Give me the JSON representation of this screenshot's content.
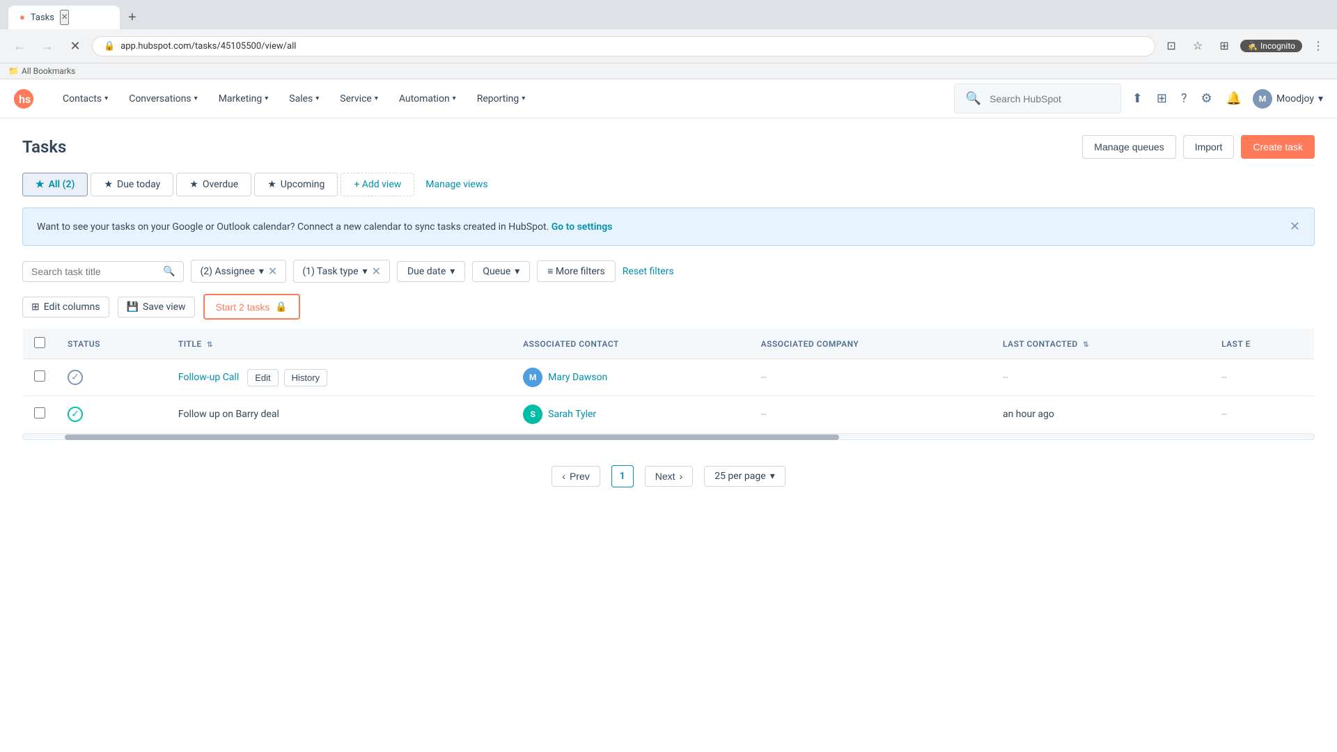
{
  "browser": {
    "tab_title": "Tasks",
    "tab_close": "×",
    "new_tab": "+",
    "url": "app.hubspot.com/tasks/45105500/view/all",
    "nav": {
      "back": "←",
      "forward": "→",
      "reload": "✕",
      "home": "⌂"
    },
    "actions": {
      "cast": "⊡",
      "bookmark": "☆",
      "extensions": "⊞",
      "menu": "⋮"
    },
    "incognito_label": "Incognito",
    "bookmarks_label": "All Bookmarks"
  },
  "topnav": {
    "logo_icon": "hs-logo",
    "nav_items": [
      {
        "label": "Contacts",
        "has_dropdown": true
      },
      {
        "label": "Conversations",
        "has_dropdown": true
      },
      {
        "label": "Marketing",
        "has_dropdown": true
      },
      {
        "label": "Sales",
        "has_dropdown": true
      },
      {
        "label": "Service",
        "has_dropdown": true
      },
      {
        "label": "Automation",
        "has_dropdown": true
      },
      {
        "label": "Reporting",
        "has_dropdown": true
      }
    ],
    "search_placeholder": "Search HubSpot",
    "user_name": "Moodjoy",
    "user_initials": "M"
  },
  "page": {
    "title": "Tasks",
    "actions": {
      "manage_queues": "Manage queues",
      "import": "Import",
      "create_task": "Create task"
    }
  },
  "tabs": [
    {
      "label": "All (2)",
      "active": true,
      "icon": "★"
    },
    {
      "label": "Due today",
      "active": false,
      "icon": "★"
    },
    {
      "label": "Overdue",
      "active": false,
      "icon": "★"
    },
    {
      "label": "Upcoming",
      "active": false,
      "icon": "★"
    }
  ],
  "add_view_label": "+ Add view",
  "manage_views_label": "Manage views",
  "banner": {
    "text": "Want to see your tasks on your Google or Outlook calendar?",
    "detail": "Connect a new calendar to sync tasks created in HubSpot.",
    "link_label": "Go to settings"
  },
  "filters": {
    "search_placeholder": "Search task title",
    "chips": [
      {
        "label": "(2) Assignee",
        "removable": true
      },
      {
        "label": "(1) Task type",
        "removable": true
      }
    ],
    "buttons": [
      {
        "label": "Due date"
      },
      {
        "label": "Queue"
      }
    ],
    "more_filters": "≡ More filters",
    "reset_filters": "Reset filters"
  },
  "toolbar": {
    "edit_columns": "Edit columns",
    "save_view": "Save view",
    "start_tasks": "Start 2 tasks",
    "lock_icon": "🔒"
  },
  "table": {
    "columns": [
      {
        "label": "STATUS"
      },
      {
        "label": "TITLE",
        "sortable": true
      },
      {
        "label": "ASSOCIATED CONTACT"
      },
      {
        "label": "ASSOCIATED COMPANY"
      },
      {
        "label": "LAST CONTACTED",
        "sortable": true
      },
      {
        "label": "LAST E"
      }
    ],
    "rows": [
      {
        "status": "pending",
        "title": "Follow-up Call",
        "title_link": true,
        "actions": [
          "Edit",
          "History"
        ],
        "contact_name": "Mary Dawson",
        "contact_initials": "M",
        "contact_color": "blue",
        "company": "",
        "last_contacted": "--",
        "last_e": "--"
      },
      {
        "status": "completed",
        "title": "Follow up on Barry deal",
        "title_link": false,
        "actions": [],
        "contact_name": "Sarah Tyler",
        "contact_initials": "S",
        "contact_color": "teal",
        "company": "",
        "last_contacted": "an hour ago",
        "last_e": "--"
      }
    ]
  },
  "pagination": {
    "prev_label": "Prev",
    "next_label": "Next",
    "current_page": "1",
    "per_page_label": "25 per page",
    "prev_icon": "‹",
    "next_icon": "›"
  }
}
